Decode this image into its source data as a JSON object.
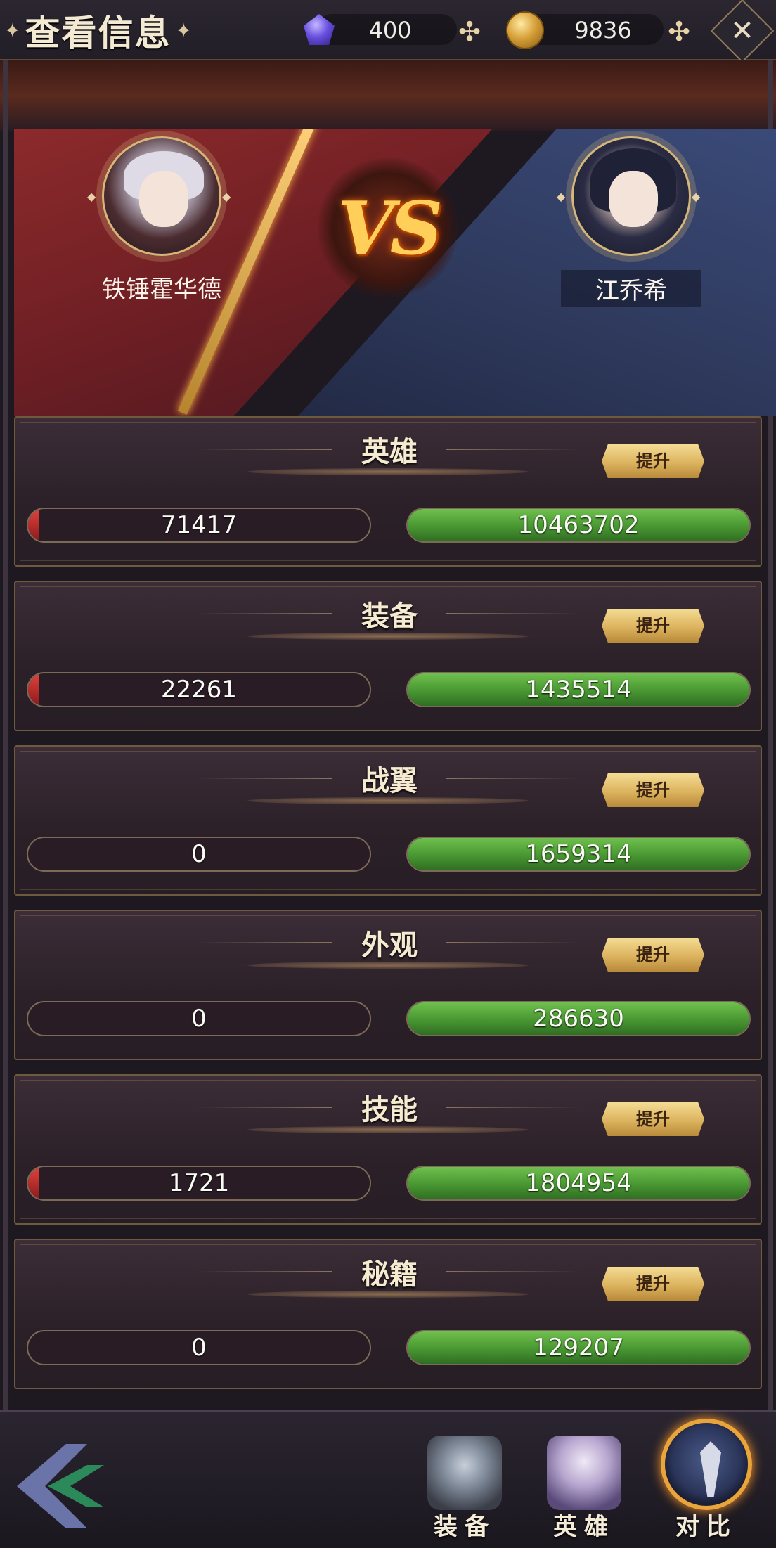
{
  "header": {
    "title": "查看信息",
    "gems": "400",
    "gold": "9836"
  },
  "versus": {
    "left_player": "铁锤霍华德",
    "right_player": "江乔希",
    "vs_text": "VS"
  },
  "stats": [
    {
      "category": "英雄",
      "upgrade_label": "提升",
      "left_value": "71417",
      "right_value": "10463702"
    },
    {
      "category": "装备",
      "upgrade_label": "提升",
      "left_value": "22261",
      "right_value": "1435514"
    },
    {
      "category": "战翼",
      "upgrade_label": "提升",
      "left_value": "0",
      "right_value": "1659314"
    },
    {
      "category": "外观",
      "upgrade_label": "提升",
      "left_value": "0",
      "right_value": "286630"
    },
    {
      "category": "技能",
      "upgrade_label": "提升",
      "left_value": "1721",
      "right_value": "1804954"
    },
    {
      "category": "秘籍",
      "upgrade_label": "提升",
      "left_value": "0",
      "right_value": "129207"
    }
  ],
  "bottom_nav": {
    "equipment_label": "装备",
    "hero_label": "英雄",
    "compare_label": "对比"
  },
  "colors": {
    "left_side": "#8c2a2c",
    "right_side": "#3a4a78",
    "bar_green": "#4b9a34",
    "bar_red": "#c8322e",
    "gold_accent": "#dcb35e"
  },
  "icons": {
    "gem": "gem-icon",
    "gold": "gold-coin-icon",
    "add": "plus-icon",
    "close": "close-icon",
    "back": "back-arrow-icon"
  }
}
